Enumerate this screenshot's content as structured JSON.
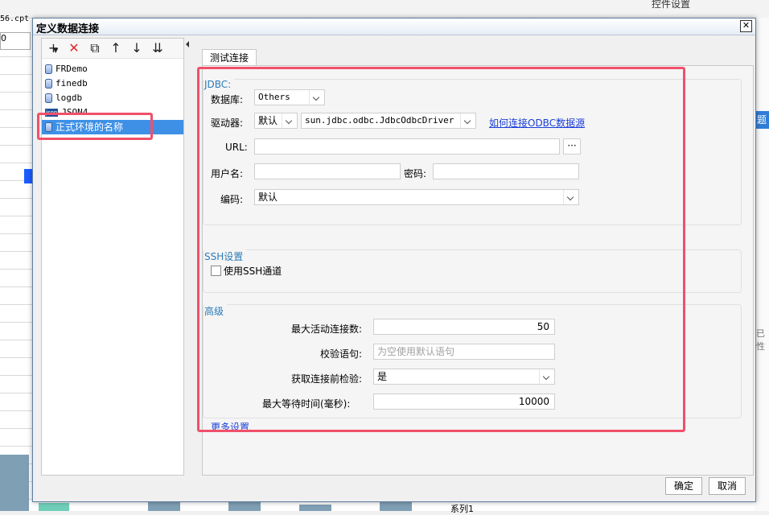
{
  "background": {
    "file_name": "56.cpt",
    "combo_value": "0",
    "top_right_text": "控件设置",
    "right_tab": "题",
    "right_text_1": "已",
    "right_text_2": "性",
    "series_label": "系列1"
  },
  "dialog": {
    "title": "定义数据连接",
    "close_glyph": "✕",
    "toolbar": {
      "add_icon": "+",
      "delete_icon": "✕",
      "copy_icon": "⧉",
      "up_icon": "↑",
      "down_icon": "↓",
      "sort_icon": "⇊"
    },
    "connections": [
      {
        "name": "FRDemo",
        "icon": "database-icon"
      },
      {
        "name": "finedb",
        "icon": "database-icon"
      },
      {
        "name": "logdb",
        "icon": "database-icon"
      },
      {
        "name": "JSON4",
        "icon": "json-icon"
      },
      {
        "name": "正式环境的名称",
        "icon": "database-icon",
        "selected": true
      }
    ],
    "json_badge": "json",
    "test_tab": "测试连接",
    "jdbc": {
      "section_title": "JDBC:",
      "database_label": "数据库:",
      "database_value": "Others",
      "driver_label": "驱动器:",
      "driver_mode": "默认",
      "driver_value": "sun.jdbc.odbc.JdbcOdbcDriver",
      "odbc_link": "如何连接ODBC数据源",
      "url_label": "URL:",
      "url_value": "",
      "url_button": "···",
      "username_label": "用户名:",
      "username_value": "",
      "password_label": "密码:",
      "password_value": "",
      "encoding_label": "编码:",
      "encoding_value": "默认"
    },
    "ssh": {
      "section_title": "SSH设置",
      "use_ssh_label": "使用SSH通道",
      "use_ssh_checked": false
    },
    "advanced": {
      "section_title": "高级",
      "max_active_label": "最大活动连接数:",
      "max_active_value": "50",
      "validation_label": "校验语句:",
      "validation_placeholder": "为空使用默认语句",
      "test_before_label": "获取连接前检验:",
      "test_before_value": "是",
      "max_wait_label": "最大等待时间(毫秒):",
      "max_wait_value": "10000",
      "more_settings_link": "更多设置"
    },
    "ok_button": "确定",
    "cancel_button": "取消"
  },
  "colors": {
    "highlight": "#f0506a",
    "selected_row": "#3d90e6",
    "section_title": "#2c7bb8",
    "link": "#1a3fd8"
  }
}
